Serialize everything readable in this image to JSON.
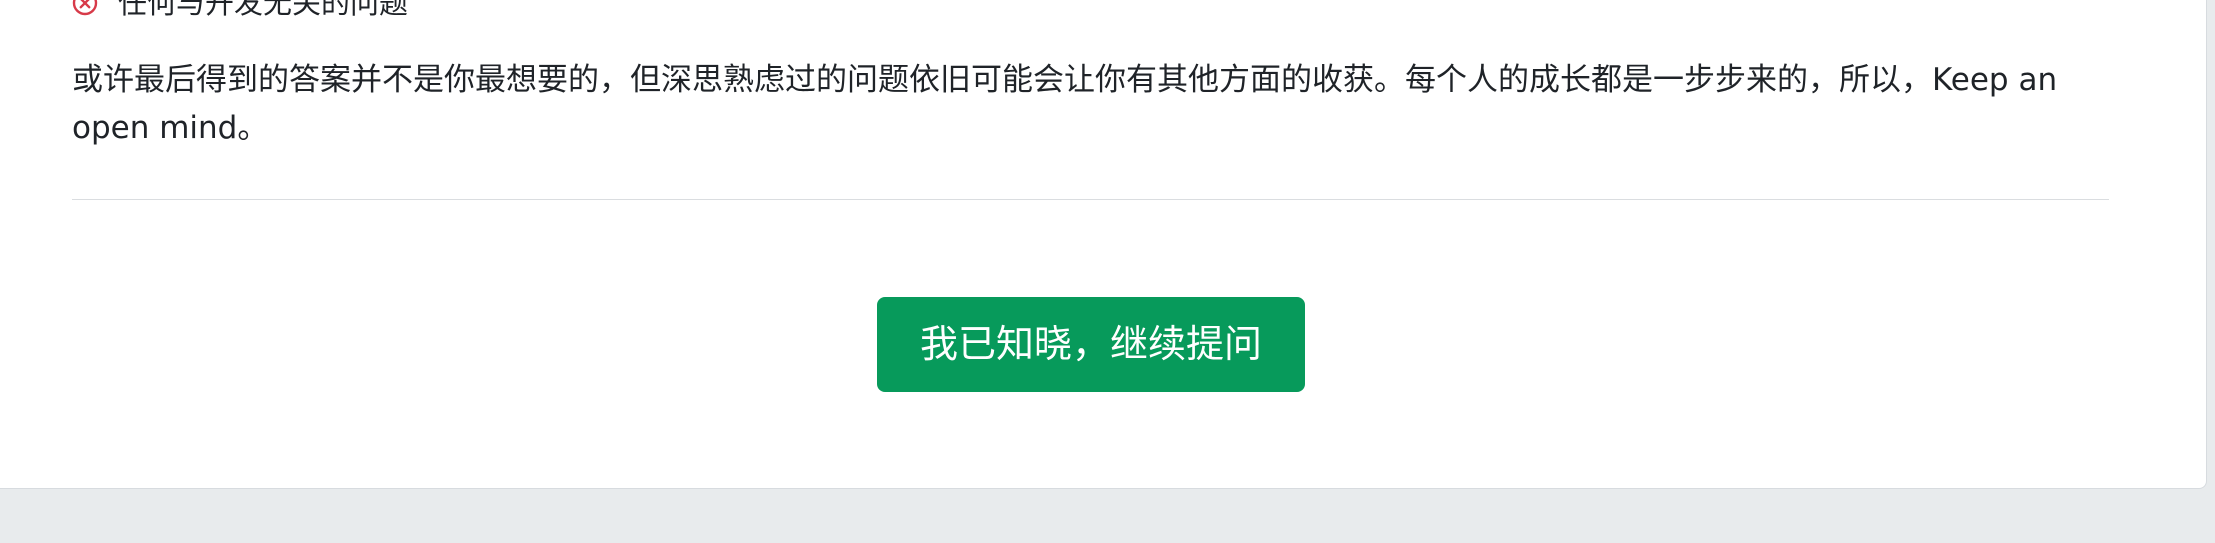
{
  "rule_item": {
    "label": "任何与开发无关的问题",
    "icon": "circle-x-icon",
    "icon_color": "#d73a49"
  },
  "note_text": "或许最后得到的答案并不是你最想要的，但深思熟虑过的问题依旧可能会让你有其他方面的收获。每个人的成长都是一步步来的，所以，Keep an open mind。",
  "ack_button": {
    "label": "我已知晓，继续提问",
    "color": "#079a5b"
  }
}
